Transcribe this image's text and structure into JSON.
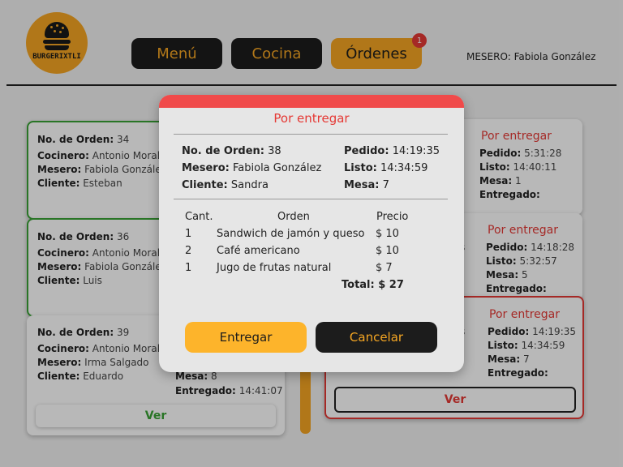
{
  "header": {
    "logo_text": "BURGERIXTLI",
    "nav": [
      {
        "label": "Menú"
      },
      {
        "label": "Cocina"
      },
      {
        "label": "Órdenes",
        "badge": "1"
      }
    ],
    "mesero_text": "MESERO: Fabiola González"
  },
  "cards_left": [
    {
      "orden": "34",
      "cocinero": "Antonio Morale",
      "mesero": "Fabiola González",
      "cliente": "Esteban"
    },
    {
      "orden": "36",
      "cocinero": "Antonio Morale",
      "mesero": "Fabiola González",
      "cliente": "Luis"
    },
    {
      "orden": "39",
      "cocinero": "Antonio Morale",
      "mesero": "Irma Salgado",
      "cliente": "Eduardo",
      "mesa": "8",
      "entregado": "14:41:07",
      "ver_label": "Ver"
    }
  ],
  "cards_right": [
    {
      "status": "Por entregar",
      "pedido": "5:31:28",
      "listo": "14:40:11",
      "mesa": "1",
      "entregado": ""
    },
    {
      "status": "Por entregar",
      "pedido": "14:18:28",
      "listo": "5:32:57",
      "mesa": "5",
      "entregado": "",
      "partial_s": "s"
    },
    {
      "status": "Por entregar",
      "pedido": "14:19:35",
      "listo": "14:34:59",
      "mesa": "7",
      "entregado": "",
      "ver_label": "Ver",
      "partial_s": "s"
    }
  ],
  "labels": {
    "orden": "No. de Orden:",
    "cocinero": "Cocinero:",
    "mesero": "Mesero:",
    "cliente": "Cliente:",
    "pedido": "Pedido:",
    "listo": "Listo:",
    "mesa": "Mesa:",
    "entregado": "Entregado:"
  },
  "modal": {
    "title": "Por entregar",
    "orden_label": "No. de Orden:",
    "orden": "38",
    "mesero_label": "Mesero:",
    "mesero": "Fabiola González",
    "cliente_label": "Cliente:",
    "cliente": "Sandra",
    "pedido_label": "Pedido:",
    "pedido": "14:19:35",
    "listo_label": "Listo:",
    "listo": "14:34:59",
    "mesa_label": "Mesa:",
    "mesa": "7",
    "table_headers": {
      "cant": "Cant.",
      "orden": "Orden",
      "precio": "Precio"
    },
    "items": [
      {
        "cant": "1",
        "name": "Sandwich de jamón y queso",
        "price": "$ 10"
      },
      {
        "cant": "2",
        "name": "Café americano",
        "price": "$ 10"
      },
      {
        "cant": "1",
        "name": "Jugo de frutas natural",
        "price": "$ 7"
      }
    ],
    "total": "Total: $ 27",
    "entregar_label": "Entregar",
    "cancelar_label": "Cancelar"
  },
  "colors": {
    "accent": "#f5a623",
    "danger": "#e53935",
    "success": "#3aa335",
    "dark": "#1c1c1c"
  }
}
